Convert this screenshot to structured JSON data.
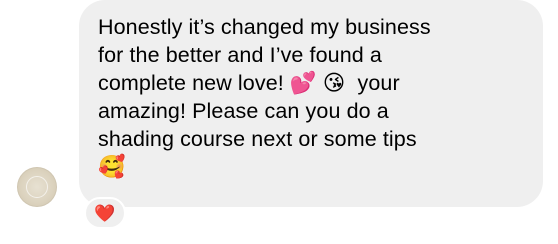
{
  "message": {
    "text_lines": [
      "Honestly it’s changed my business",
      "for the better and I’ve found a",
      "complete new love! 💕 😘  your",
      "amazing! Please can you do a",
      "shading course next or some tips",
      "🥰"
    ],
    "bubble_color": "#efefef",
    "text_color": "#000000"
  },
  "sender": {
    "avatar_icon": "gold-coin-avatar"
  },
  "reaction": {
    "emoji": "❤️",
    "icon": "red-heart-icon"
  }
}
